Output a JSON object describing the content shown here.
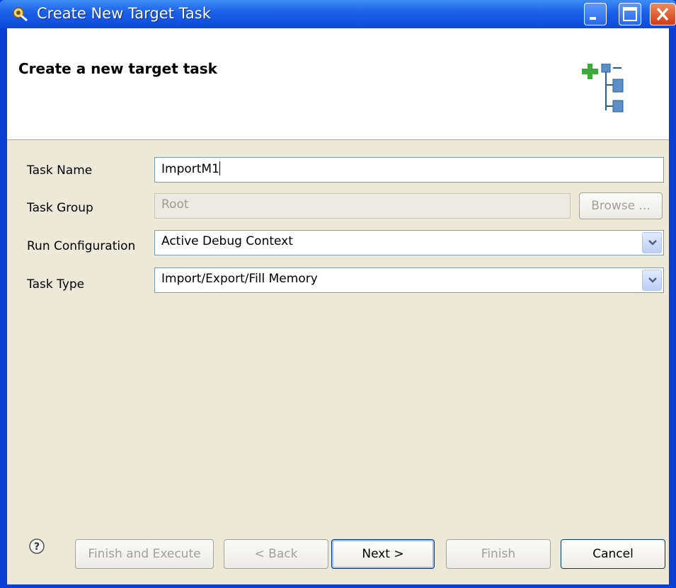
{
  "window": {
    "title": "Create New Target Task",
    "controls": {
      "minimize": "minimize-icon",
      "maximize": "maximize-icon",
      "close": "close-icon"
    },
    "titlebar_color": "#1c5fe6"
  },
  "banner": {
    "heading": "Create a new target task",
    "icon": "add-task-tree-icon"
  },
  "form": {
    "task_name": {
      "label": "Task Name",
      "value": "ImportM1"
    },
    "task_group": {
      "label": "Task Group",
      "value": "Root",
      "browse_label": "Browse ..."
    },
    "run_configuration": {
      "label": "Run Configuration",
      "value": "Active Debug Context"
    },
    "task_type": {
      "label": "Task Type",
      "value": "Import/Export/Fill Memory"
    }
  },
  "footer": {
    "help_icon": "help-icon",
    "buttons": {
      "finish_and_execute": "Finish and Execute",
      "back": "< Back",
      "next": "Next >",
      "finish": "Finish",
      "cancel": "Cancel"
    }
  }
}
